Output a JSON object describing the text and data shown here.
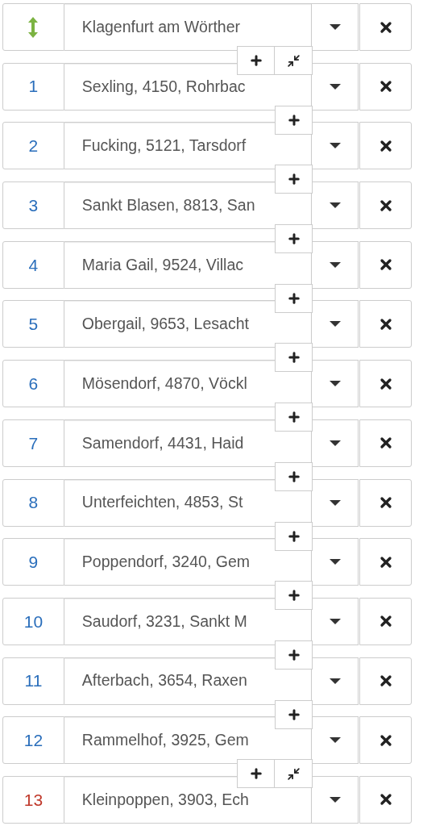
{
  "rows": [
    {
      "marker": {
        "kind": "icon",
        "color": "#7cb342"
      },
      "place": "Klagenfurt am Wörther",
      "insert_button": true,
      "merge_button": true
    },
    {
      "marker": {
        "kind": "number",
        "label": "1",
        "color": "#2a6ebb"
      },
      "place": "Sexling, 4150, Rohrbac",
      "insert_button": true,
      "merge_button": false
    },
    {
      "marker": {
        "kind": "number",
        "label": "2",
        "color": "#2a6ebb"
      },
      "place": "Fucking, 5121, Tarsdorf",
      "insert_button": true,
      "merge_button": false
    },
    {
      "marker": {
        "kind": "number",
        "label": "3",
        "color": "#2a6ebb"
      },
      "place": "Sankt Blasen, 8813, San",
      "insert_button": true,
      "merge_button": false
    },
    {
      "marker": {
        "kind": "number",
        "label": "4",
        "color": "#2a6ebb"
      },
      "place": "Maria Gail, 9524, Villac",
      "insert_button": true,
      "merge_button": false
    },
    {
      "marker": {
        "kind": "number",
        "label": "5",
        "color": "#2a6ebb"
      },
      "place": "Obergail, 9653, Lesacht",
      "insert_button": true,
      "merge_button": false
    },
    {
      "marker": {
        "kind": "number",
        "label": "6",
        "color": "#2a6ebb"
      },
      "place": "Mösendorf, 4870, Vöckl",
      "insert_button": true,
      "merge_button": false
    },
    {
      "marker": {
        "kind": "number",
        "label": "7",
        "color": "#2a6ebb"
      },
      "place": "Samendorf, 4431, Haid",
      "insert_button": true,
      "merge_button": false
    },
    {
      "marker": {
        "kind": "number",
        "label": "8",
        "color": "#2a6ebb"
      },
      "place": "Unterfeichten, 4853, St",
      "insert_button": true,
      "merge_button": false
    },
    {
      "marker": {
        "kind": "number",
        "label": "9",
        "color": "#2a6ebb"
      },
      "place": "Poppendorf, 3240, Gem",
      "insert_button": true,
      "merge_button": false
    },
    {
      "marker": {
        "kind": "number",
        "label": "10",
        "color": "#2a6ebb"
      },
      "place": "Saudorf, 3231, Sankt M",
      "insert_button": true,
      "merge_button": false
    },
    {
      "marker": {
        "kind": "number",
        "label": "11",
        "color": "#2a6ebb"
      },
      "place": "Afterbach, 3654, Raxen",
      "insert_button": true,
      "merge_button": false
    },
    {
      "marker": {
        "kind": "number",
        "label": "12",
        "color": "#2a6ebb"
      },
      "place": "Rammelhof, 3925, Gem",
      "insert_button": true,
      "merge_button": true
    },
    {
      "marker": {
        "kind": "number",
        "label": "13",
        "color": "#c0392b"
      },
      "place": "Kleinpoppen, 3903, Ech",
      "insert_button": false,
      "merge_button": false
    }
  ]
}
